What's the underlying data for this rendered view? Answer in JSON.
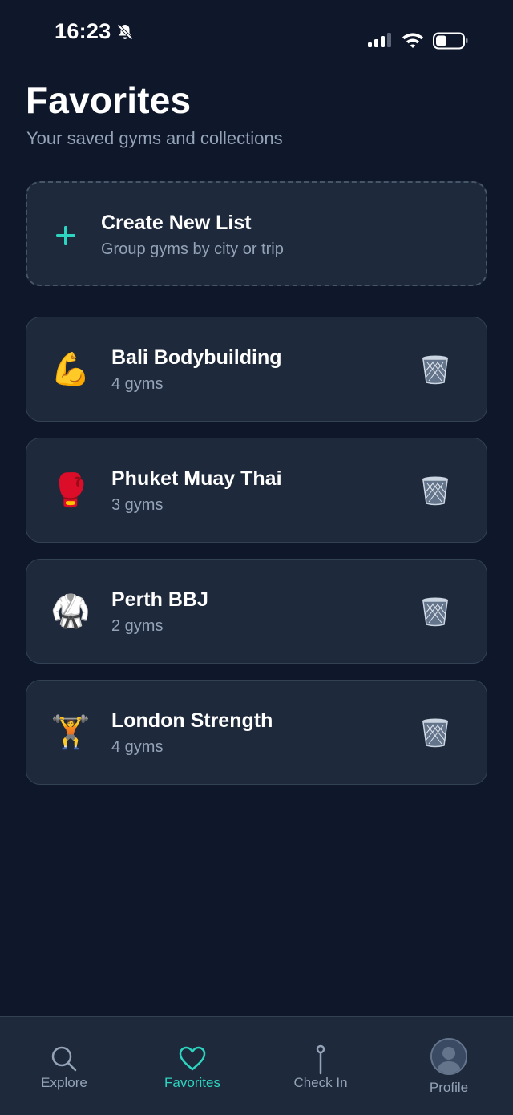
{
  "status_bar": {
    "time": "16:23"
  },
  "header": {
    "title": "Favorites",
    "subtitle": "Your saved gyms and collections"
  },
  "create_list": {
    "title": "Create New List",
    "subtitle": "Group gyms by city or trip",
    "accent_color": "#2dd4bf"
  },
  "lists": [
    {
      "emoji": "💪",
      "icon": "flexed-biceps-icon",
      "name": "Bali Bodybuilding",
      "count": "4 gyms"
    },
    {
      "emoji": "🥊",
      "icon": "boxing-glove-icon",
      "name": "Phuket Muay Thai",
      "count": "3 gyms"
    },
    {
      "emoji": "🥋",
      "icon": "martial-arts-uniform-icon",
      "name": "Perth BBJ",
      "count": "2 gyms"
    },
    {
      "emoji": "🏋️",
      "icon": "weightlifter-icon",
      "name": "London Strength",
      "count": "4 gyms"
    }
  ],
  "tab_bar": {
    "active": "Favorites",
    "active_color": "#2dd4bf",
    "tabs": [
      {
        "label": "Explore",
        "icon": "search-icon"
      },
      {
        "label": "Favorites",
        "icon": "heart-icon"
      },
      {
        "label": "Check In",
        "icon": "pin-icon"
      },
      {
        "label": "Profile",
        "icon": "avatar-icon"
      }
    ]
  }
}
